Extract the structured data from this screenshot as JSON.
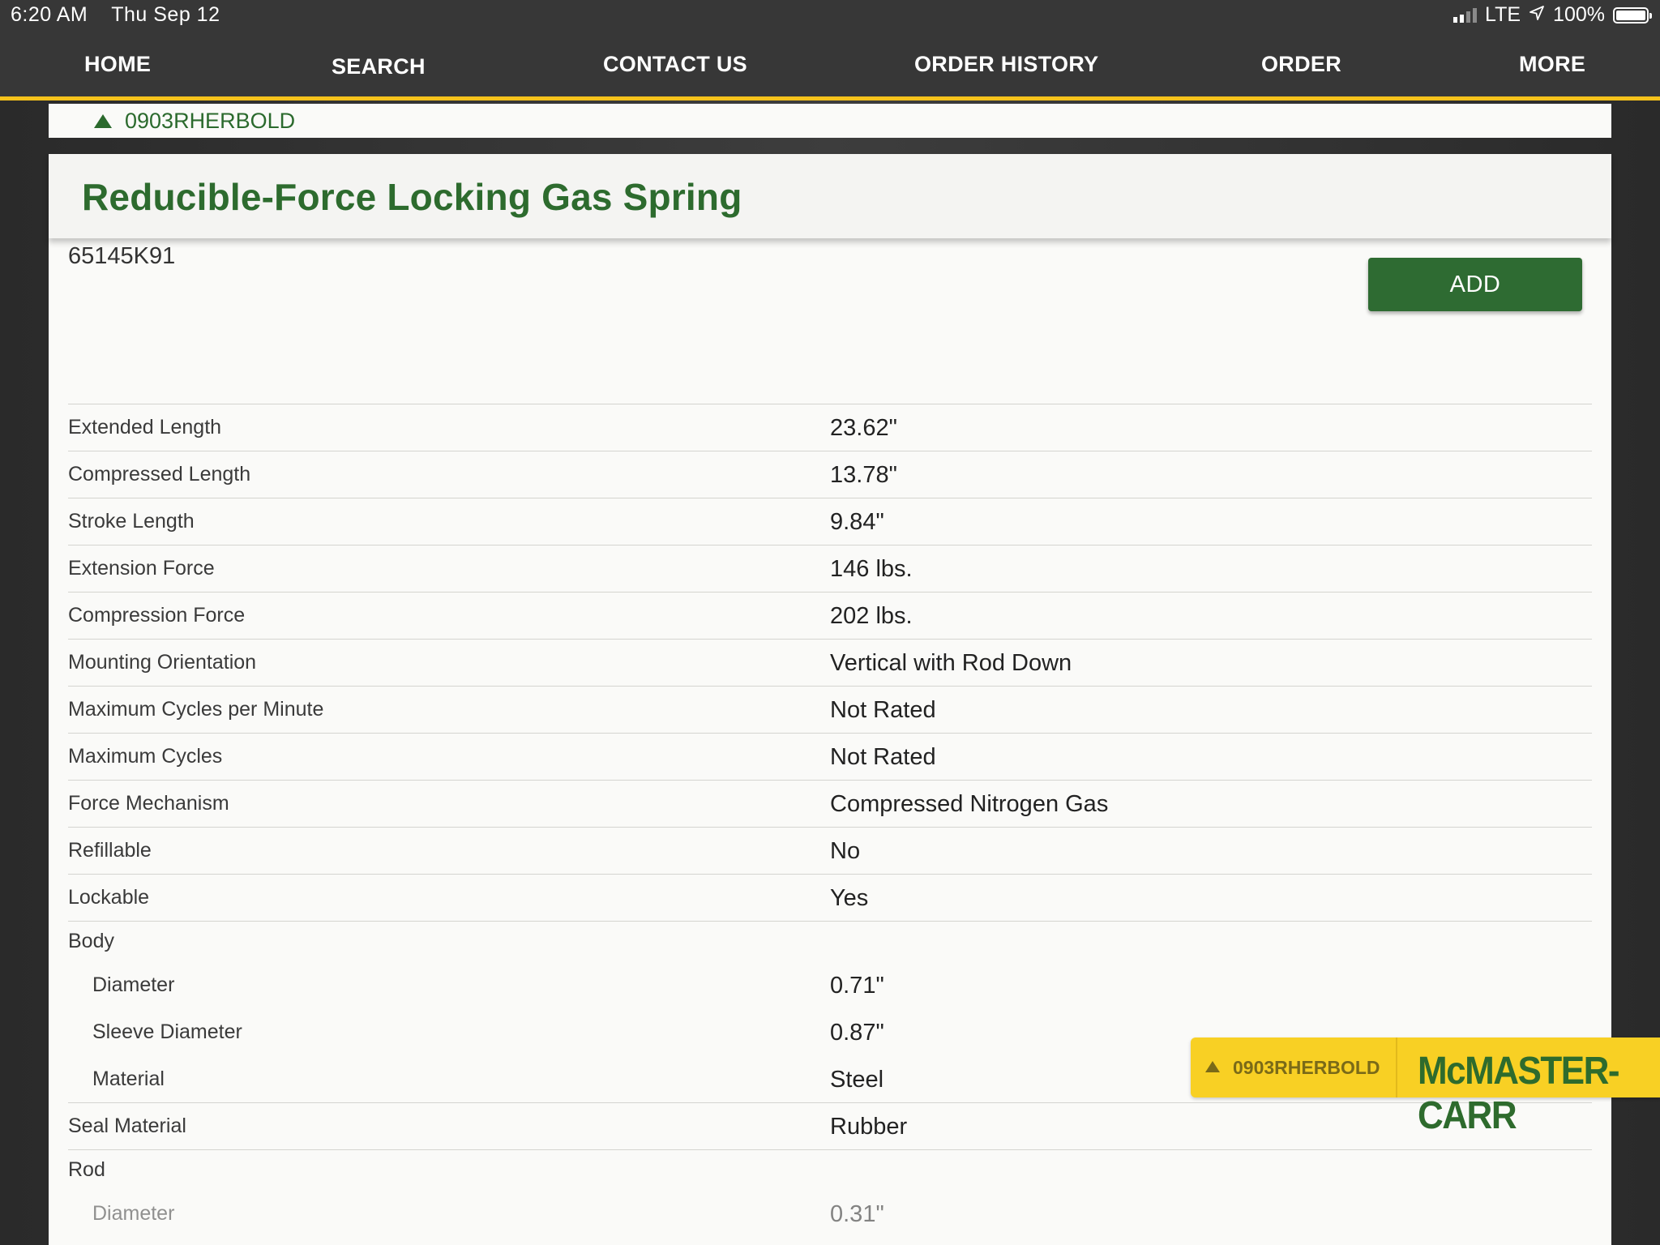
{
  "status": {
    "time": "6:20 AM",
    "date": "Thu Sep 12",
    "network": "LTE",
    "battery": "100%"
  },
  "nav": {
    "items": [
      {
        "label": "HOME"
      },
      {
        "label": "SEARCH"
      },
      {
        "label": "CONTACT US"
      },
      {
        "label": "ORDER HISTORY"
      },
      {
        "label": "ORDER"
      },
      {
        "label": "MORE"
      }
    ]
  },
  "breadcrumb": {
    "account": "0903RHERBOLD"
  },
  "product": {
    "title": "Reducible-Force Locking Gas Spring",
    "part_number": "65145K91",
    "add_label": "ADD"
  },
  "specs": [
    {
      "label": "Extended Length",
      "value": "23.62\""
    },
    {
      "label": "Compressed Length",
      "value": "13.78\""
    },
    {
      "label": "Stroke Length",
      "value": "9.84\""
    },
    {
      "label": "Extension Force",
      "value": "146 lbs."
    },
    {
      "label": "Compression Force",
      "value": "202 lbs."
    },
    {
      "label": "Mounting Orientation",
      "value": "Vertical with Rod Down"
    },
    {
      "label": "Maximum Cycles per Minute",
      "value": "Not Rated"
    },
    {
      "label": "Maximum Cycles",
      "value": "Not Rated"
    },
    {
      "label": "Force Mechanism",
      "value": "Compressed Nitrogen Gas"
    },
    {
      "label": "Refillable",
      "value": "No"
    },
    {
      "label": "Lockable",
      "value": "Yes"
    }
  ],
  "body_group": {
    "label": "Body",
    "items": [
      {
        "label": "Diameter",
        "value": "0.71\""
      },
      {
        "label": "Sleeve Diameter",
        "value": "0.87\""
      },
      {
        "label": "Material",
        "value": "Steel"
      }
    ]
  },
  "seal": {
    "label": "Seal Material",
    "value": "Rubber"
  },
  "rod_group": {
    "label": "Rod",
    "items": [
      {
        "label": "Diameter",
        "value": "0.31\""
      }
    ]
  },
  "badge": {
    "account": "0903RHERBOLD",
    "logo": "McMASTER-CARR"
  },
  "colors": {
    "brand_green": "#2e6b32",
    "brand_yellow": "#f6c21b",
    "nav_bg": "#373737"
  }
}
